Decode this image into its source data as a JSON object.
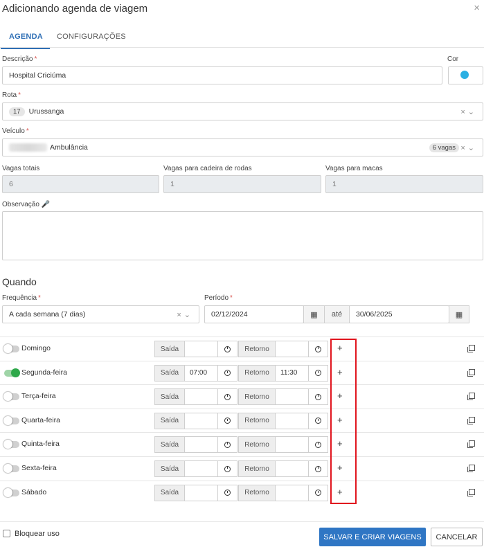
{
  "dialog": {
    "title": "Adicionando agenda de viagem",
    "close_icon": "×"
  },
  "tabs": [
    {
      "label": "AGENDA",
      "active": true
    },
    {
      "label": "CONFIGURAÇÕES",
      "active": false
    }
  ],
  "form": {
    "descricao": {
      "label": "Descrição",
      "value": "Hospital Criciúma"
    },
    "cor": {
      "label": "Cor",
      "value": "#2bb0e3"
    },
    "rota": {
      "label": "Rota",
      "code": "17",
      "value": "Urussanga"
    },
    "veiculo": {
      "label": "Veículo",
      "value": "Ambulância",
      "badge": "6 vagas"
    },
    "vagas_totais": {
      "label": "Vagas totais",
      "value": "6"
    },
    "vagas_cadeira": {
      "label": "Vagas para cadeira de rodas",
      "value": "1"
    },
    "vagas_macas": {
      "label": "Vagas para macas",
      "value": "1"
    },
    "observacao": {
      "label": "Observação",
      "value": ""
    }
  },
  "quando": {
    "heading": "Quando",
    "frequencia": {
      "label": "Frequência",
      "value": "A cada semana (7 dias)"
    },
    "periodo": {
      "label": "Período",
      "start": "02/12/2024",
      "sep": "até",
      "end": "30/06/2025"
    }
  },
  "schedule": {
    "saida_label": "Saída",
    "retorno_label": "Retorno",
    "add_symbol": "+",
    "days": [
      {
        "name": "Domingo",
        "enabled": false,
        "saida": "",
        "retorno": ""
      },
      {
        "name": "Segunda-feira",
        "enabled": true,
        "saida": "07:00",
        "retorno": "11:30"
      },
      {
        "name": "Terça-feira",
        "enabled": false,
        "saida": "",
        "retorno": ""
      },
      {
        "name": "Quarta-feira",
        "enabled": false,
        "saida": "",
        "retorno": ""
      },
      {
        "name": "Quinta-feira",
        "enabled": false,
        "saida": "",
        "retorno": ""
      },
      {
        "name": "Sexta-feira",
        "enabled": false,
        "saida": "",
        "retorno": ""
      },
      {
        "name": "Sábado",
        "enabled": false,
        "saida": "",
        "retorno": ""
      }
    ]
  },
  "footer": {
    "bloquear_label": "Bloquear uso",
    "save_label": "SALVAR E CRIAR VIAGENS",
    "cancel_label": "CANCELAR"
  },
  "colors": {
    "accent": "#2f76c4",
    "required": "#d9534f",
    "toggle_on": "#2ea84a",
    "highlight": "#e0141e"
  }
}
